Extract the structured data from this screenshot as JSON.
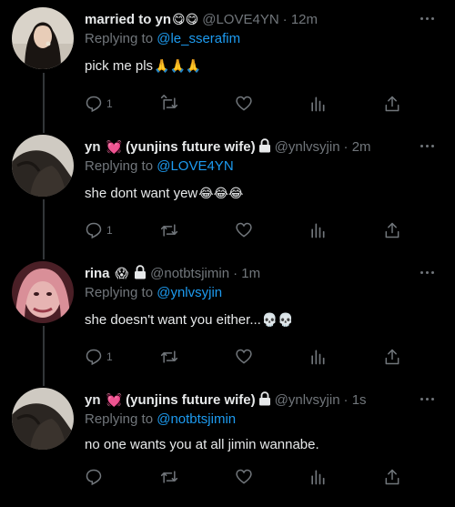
{
  "reply_prefix": "Replying to",
  "tweets": [
    {
      "display_name": "married to yn",
      "name_emoji": "😋😋",
      "locked": false,
      "handle": "@LOVE4YN",
      "time": "· 12m",
      "replying_to": "@le_sserafim",
      "text": "pick me pls",
      "text_emoji": "🙏🙏🙏",
      "reply_count": "1"
    },
    {
      "display_name": "yn",
      "name_emoji": "💓",
      "display_name_2": "(yunjins future wife)",
      "locked": true,
      "handle": "@ynlvsyjin",
      "time": "· 2m",
      "replying_to": "@LOVE4YN",
      "text": "she dont want yew",
      "text_emoji": "😂😂😂",
      "reply_count": "1"
    },
    {
      "display_name": "rina",
      "name_emoji": "😱",
      "locked": true,
      "handle": "@notbtsjimin",
      "time": "· 1m",
      "replying_to": "@ynlvsyjin",
      "text": "she doesn't want you either...",
      "text_emoji": "💀💀",
      "reply_count": "1"
    },
    {
      "display_name": "yn",
      "name_emoji": "💓",
      "display_name_2": "(yunjins future wife)",
      "locked": true,
      "handle": "@ynlvsyjin",
      "time": "· 1s",
      "replying_to": "@notbtsjimin",
      "text": "no one wants you at all jimin wannabe.",
      "text_emoji": "",
      "reply_count": ""
    }
  ],
  "icons": [
    "reply-icon",
    "retweet-icon",
    "like-icon",
    "analytics-icon",
    "share-icon",
    "more-icon",
    "lock-icon"
  ],
  "colors": {
    "background": "#000000",
    "text": "#e7e9ea",
    "muted": "#71767b",
    "link": "#1d9bf0",
    "thread_line": "#333639"
  }
}
